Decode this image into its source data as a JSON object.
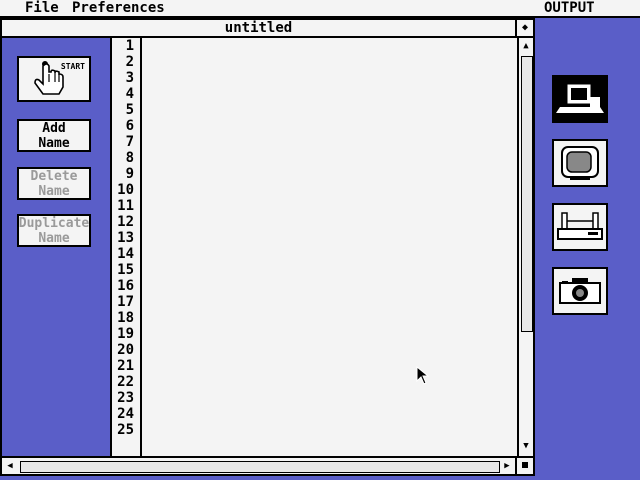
{
  "menubar": {
    "file": "File",
    "preferences": "Preferences",
    "output": "OUTPUT"
  },
  "window": {
    "title": "untitled"
  },
  "buttons": {
    "start": "START",
    "add_name_line1": "Add",
    "add_name_line2": "Name",
    "delete_name_line1": "Delete",
    "delete_name_line2": "Name",
    "duplicate_name_line1": "Duplicate",
    "duplicate_name_line2": "Name"
  },
  "line_numbers": [
    "1",
    "2",
    "3",
    "4",
    "5",
    "6",
    "7",
    "8",
    "9",
    "10",
    "11",
    "12",
    "13",
    "14",
    "15",
    "16",
    "17",
    "18",
    "19",
    "20",
    "21",
    "22",
    "23",
    "24",
    "25"
  ],
  "output_icons": [
    "computer-icon",
    "monitor-icon",
    "printer-icon",
    "camera-icon"
  ],
  "colors": {
    "desktop": "#5a5ec8",
    "panel": "#f4f4f4",
    "disabled_text": "#9a9a9a"
  }
}
